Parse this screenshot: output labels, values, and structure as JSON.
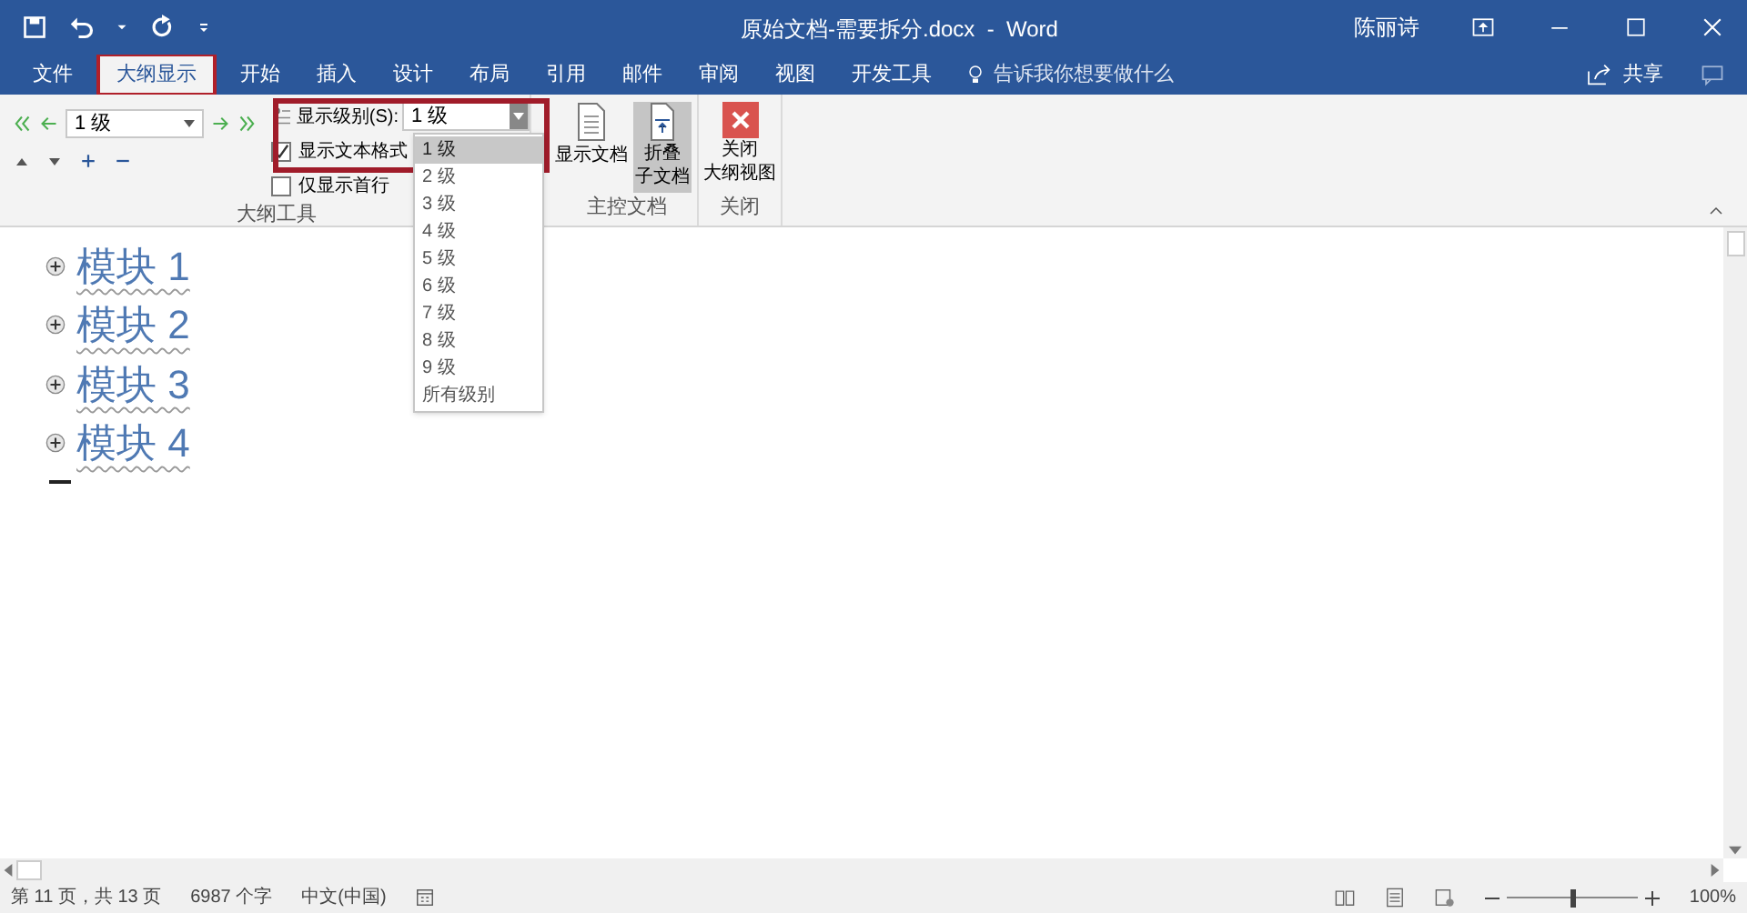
{
  "window": {
    "title": "原始文档-需要拆分.docx  -  Word",
    "user": "陈丽诗"
  },
  "tabs": [
    {
      "label": "文件",
      "selected": false
    },
    {
      "label": "大纲显示",
      "selected": true
    },
    {
      "label": "开始",
      "selected": false
    },
    {
      "label": "插入",
      "selected": false
    },
    {
      "label": "设计",
      "selected": false
    },
    {
      "label": "布局",
      "selected": false
    },
    {
      "label": "引用",
      "selected": false
    },
    {
      "label": "邮件",
      "selected": false
    },
    {
      "label": "审阅",
      "selected": false
    },
    {
      "label": "视图",
      "selected": false
    },
    {
      "label": "开发工具",
      "selected": false
    }
  ],
  "tell_me": {
    "placeholder": "告诉我你想要做什么"
  },
  "share": "共享",
  "ribbon": {
    "outline_tools": {
      "level_value": "1 级",
      "show_level_label": "显示级别(S):",
      "show_level_value": "1 级",
      "show_formatting": {
        "label": "显示文本格式",
        "checked": true
      },
      "first_line_only": {
        "label": "仅显示首行",
        "checked": false
      },
      "group_label": "大纲工具"
    },
    "master": {
      "show_document": "显示文档",
      "collapse": [
        "折叠",
        "子文档"
      ],
      "collapse_on": true,
      "group_label": "主控文档"
    },
    "close": {
      "button": [
        "关闭",
        "大纲视图"
      ],
      "group_label": "关闭"
    }
  },
  "level_menu": [
    {
      "label": "1 级",
      "selected": true
    },
    {
      "label": "2 级",
      "selected": false
    },
    {
      "label": "3 级",
      "selected": false
    },
    {
      "label": "4 级",
      "selected": false
    },
    {
      "label": "5 级",
      "selected": false
    },
    {
      "label": "6 级",
      "selected": false
    },
    {
      "label": "7 级",
      "selected": false
    },
    {
      "label": "8 级",
      "selected": false
    },
    {
      "label": "9 级",
      "selected": false
    },
    {
      "label": "所有级别",
      "selected": false
    }
  ],
  "outline": [
    "模块 1",
    "模块 2",
    "模块 3",
    "模块 4"
  ],
  "status_bar": {
    "page": "第 11 页，共 13 页",
    "words": "6987 个字",
    "language": "中文(中国)",
    "zoom": {
      "level": 0.5,
      "reading": "100%"
    }
  }
}
